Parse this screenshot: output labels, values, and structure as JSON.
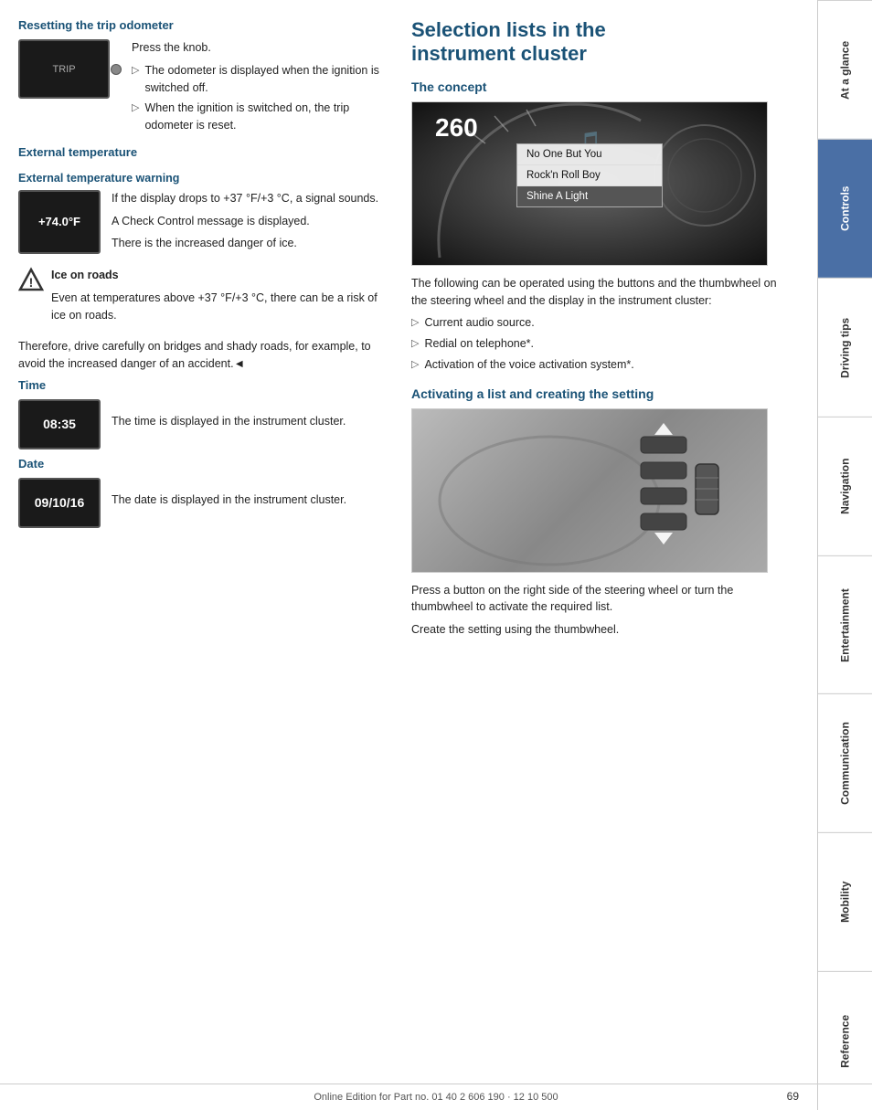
{
  "page": {
    "footer_text": "Online Edition for Part no. 01 40 2 606 190 · 12 10 500",
    "page_number": "69"
  },
  "sidebar": {
    "sections": [
      {
        "id": "at-a-glance",
        "label": "At a glance",
        "active": false
      },
      {
        "id": "controls",
        "label": "Controls",
        "active": true
      },
      {
        "id": "driving-tips",
        "label": "Driving tips",
        "active": false
      },
      {
        "id": "navigation",
        "label": "Navigation",
        "active": false
      },
      {
        "id": "entertainment",
        "label": "Entertainment",
        "active": false
      },
      {
        "id": "communication",
        "label": "Communication",
        "active": false
      },
      {
        "id": "mobility",
        "label": "Mobility",
        "active": false
      },
      {
        "id": "reference",
        "label": "Reference",
        "active": false
      }
    ]
  },
  "left": {
    "section1": {
      "heading": "Resetting the trip odometer",
      "intro": "Press the knob.",
      "bullets": [
        "The odometer is displayed when the ignition is switched off.",
        "When the ignition is switched on, the trip odometer is reset."
      ]
    },
    "section2": {
      "heading": "External temperature",
      "subheading": "External temperature warning",
      "temp_display": "+74.0°F",
      "text1": "If the display drops to +37 °F/+3 °C, a signal sounds.",
      "text2": "A Check Control message is displayed.",
      "text3": "There is the increased danger of ice.",
      "warning_title": "Ice on roads",
      "warning_text": "Even at temperatures above +37 °F/+3 °C, there can be a risk of ice on roads.",
      "extra_text": "Therefore, drive carefully on bridges and shady roads, for example, to avoid the increased danger of an accident.◄"
    },
    "section3": {
      "heading": "Time",
      "time_display": "08:35",
      "text": "The time is displayed in the instrument cluster."
    },
    "section4": {
      "heading": "Date",
      "date_display": "09/10/16",
      "text": "The date is displayed in the instrument cluster."
    }
  },
  "right": {
    "main_heading_line1": "Selection lists in the",
    "main_heading_line2": "instrument cluster",
    "concept": {
      "heading": "The concept",
      "menu_items": [
        "No One But You",
        "Rock'n Roll Boy",
        "Shine A Light"
      ],
      "speedometer_number": "260",
      "body_text": "The following can be operated using the buttons and the thumbwheel on the steering wheel and the display in the instrument cluster:",
      "bullets": [
        "Current audio source.",
        "Redial on telephone*.",
        "Activation of the voice activation system*."
      ]
    },
    "activating": {
      "heading": "Activating a list and creating the setting",
      "text1": "Press a button on the right side of the steering wheel or turn the thumbwheel to activate the required list.",
      "text2": "Create the setting using the thumbwheel."
    }
  }
}
